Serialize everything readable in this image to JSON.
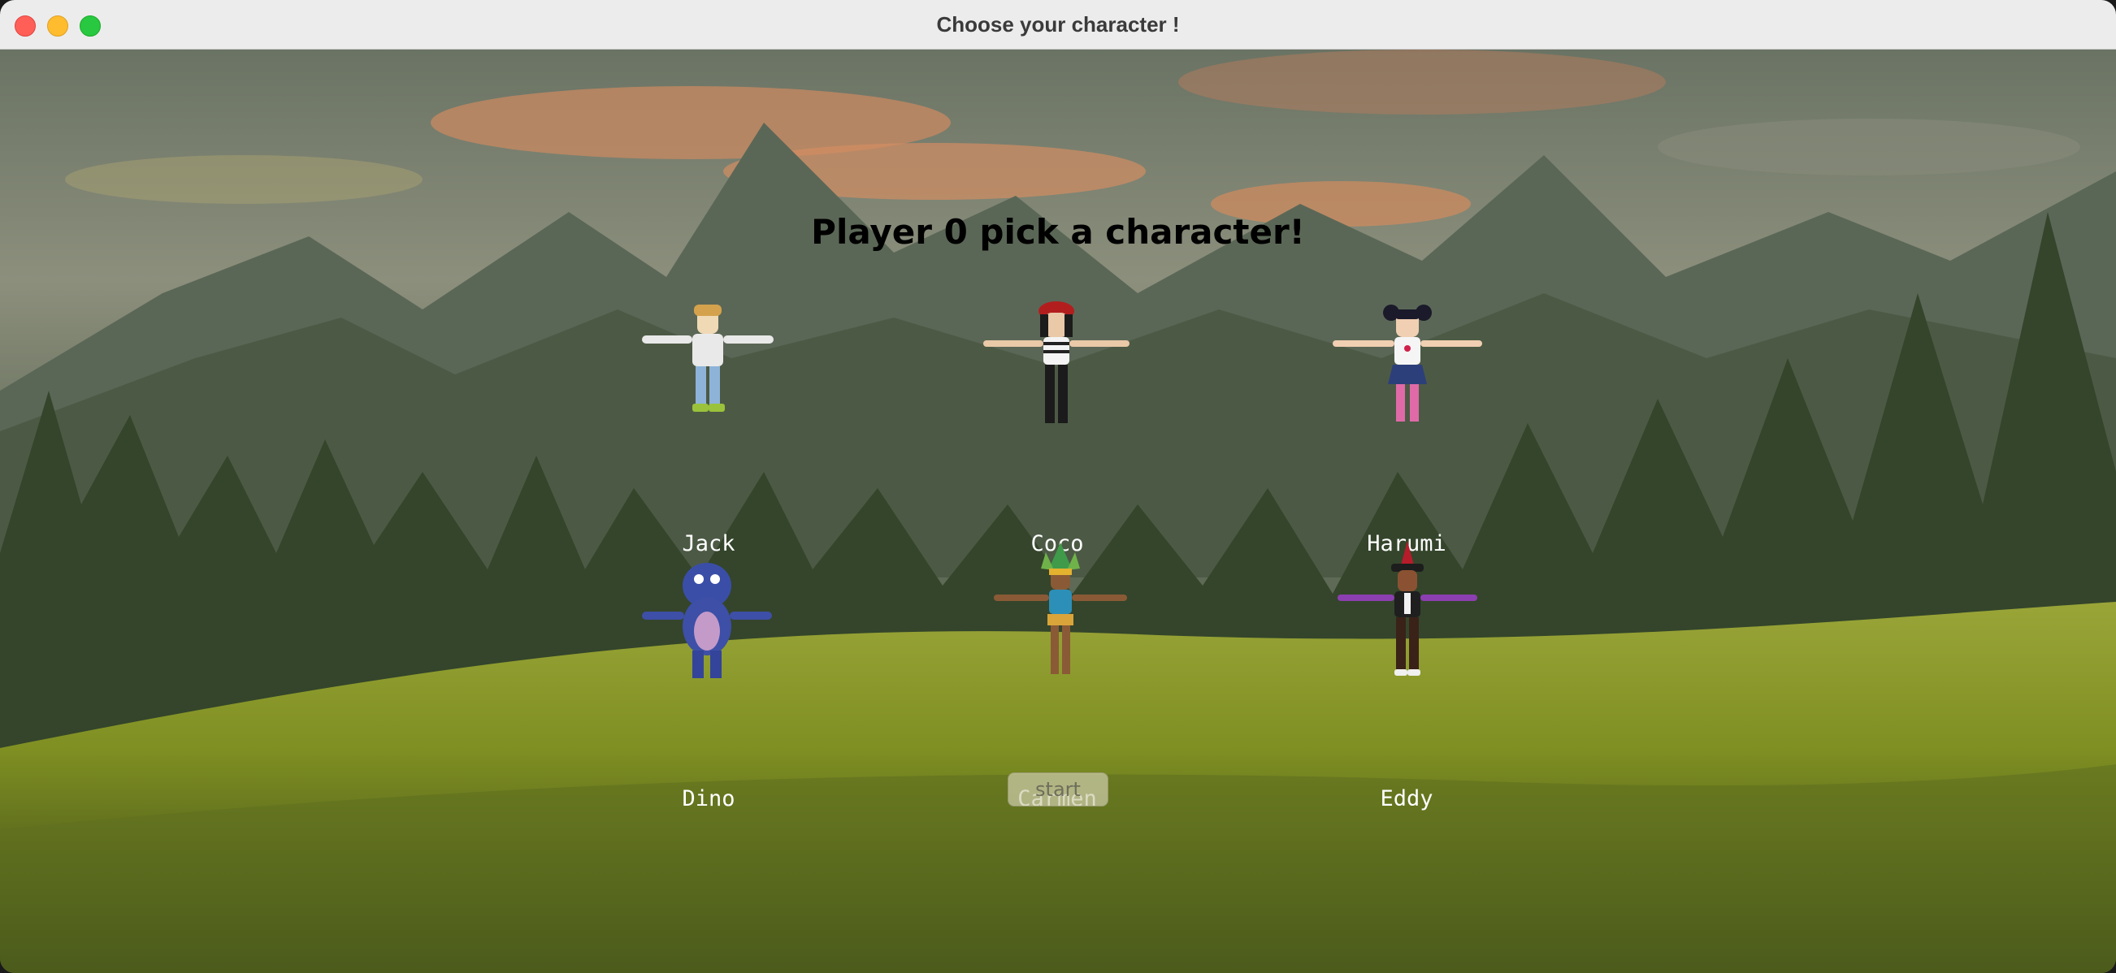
{
  "window": {
    "title": "Choose your character !"
  },
  "heading": "Player 0 pick a character!",
  "characters": [
    {
      "name": "Jack",
      "icon": "jack-character-icon"
    },
    {
      "name": "Coco",
      "icon": "coco-character-icon"
    },
    {
      "name": "Harumi",
      "icon": "harumi-character-icon"
    },
    {
      "name": "Dino",
      "icon": "dino-character-icon"
    },
    {
      "name": "Carmen",
      "icon": "carmen-character-icon"
    },
    {
      "name": "Eddy",
      "icon": "eddy-character-icon"
    }
  ],
  "start_label": "start",
  "colors": {
    "sky": "#7f8a73",
    "grass": "#8d9a2a",
    "text": "#ffffff",
    "heading": "#000000"
  }
}
